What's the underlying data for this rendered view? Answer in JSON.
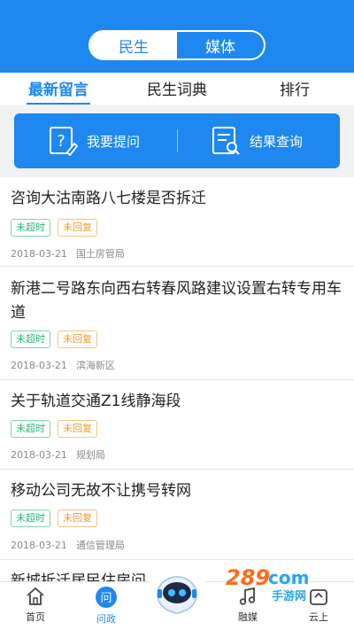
{
  "header": {
    "segments": [
      {
        "label": "民生",
        "active": true
      },
      {
        "label": "媒体",
        "active": false
      }
    ],
    "accent": "#1e88f0"
  },
  "tabs": [
    {
      "label": "最新留言",
      "active": true
    },
    {
      "label": "民生词典",
      "active": false
    },
    {
      "label": "排行",
      "active": false
    }
  ],
  "actions": {
    "ask_label": "我要提问",
    "ask_icon": "question-doc-icon",
    "result_label": "结果查询",
    "result_icon": "search-doc-icon"
  },
  "list": [
    {
      "title": "咨询大沽南路八七楼是否拆迁",
      "badges": [
        "未超时",
        "未回复"
      ],
      "date": "2018-03-21",
      "dept": "国土房管局"
    },
    {
      "title": "新港二号路东向西右转春风路建议设置右转专用车道",
      "badges": [
        "未超时",
        "未回复"
      ],
      "date": "2018-03-21",
      "dept": "滨海新区"
    },
    {
      "title": "关于轨道交通Z1线静海段",
      "badges": [
        "未超时",
        "未回复"
      ],
      "date": "2018-03-21",
      "dept": "规划局"
    },
    {
      "title": "移动公司无故不让携号转网",
      "badges": [
        "未超时",
        "未回复"
      ],
      "date": "2018-03-21",
      "dept": "通信管理局"
    },
    {
      "title": "新城拆迁居民住房问",
      "badges": [],
      "date": "",
      "dept": ""
    }
  ],
  "bottom_nav": [
    {
      "label": "首页",
      "icon": "home-icon",
      "active": false
    },
    {
      "label": "问政",
      "icon": "ask-icon",
      "active": true
    },
    {
      "label": "",
      "icon": "robot-assistant-icon",
      "active": false
    },
    {
      "label": "融媒",
      "icon": "music-note-icon",
      "active": false
    },
    {
      "label": "云上",
      "icon": "cloud-up-icon",
      "active": false
    }
  ],
  "watermark": {
    "brand": "289",
    "domain": "com",
    "sub": "手游网"
  }
}
